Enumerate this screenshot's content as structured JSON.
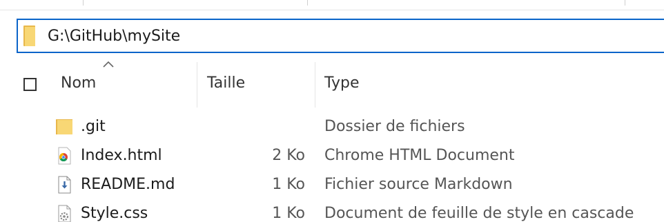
{
  "address_bar": {
    "path": "G:\\GitHub\\mySite",
    "icon": "folder-icon"
  },
  "columns": {
    "name": "Nom",
    "size": "Taille",
    "type": "Type"
  },
  "sort": {
    "column": "Nom",
    "direction": "ascending",
    "icon": "chevron-up-icon"
  },
  "files": [
    {
      "name": ".git",
      "size": "",
      "type": "Dossier de fichiers",
      "icon": "folder-icon"
    },
    {
      "name": "Index.html",
      "size": "2 Ko",
      "type": "Chrome HTML Document",
      "icon": "chrome-icon"
    },
    {
      "name": "README.md",
      "size": "1 Ko",
      "type": "Fichier source Markdown",
      "icon": "markdown-file-icon"
    },
    {
      "name": "Style.css",
      "size": "1 Ko",
      "type": "Document de feuille de style en cascade",
      "icon": "css-file-icon"
    }
  ],
  "colors": {
    "address_border": "#0a64c9",
    "folder_yellow": "#f8d775",
    "folder_dark": "#e8b74a"
  }
}
